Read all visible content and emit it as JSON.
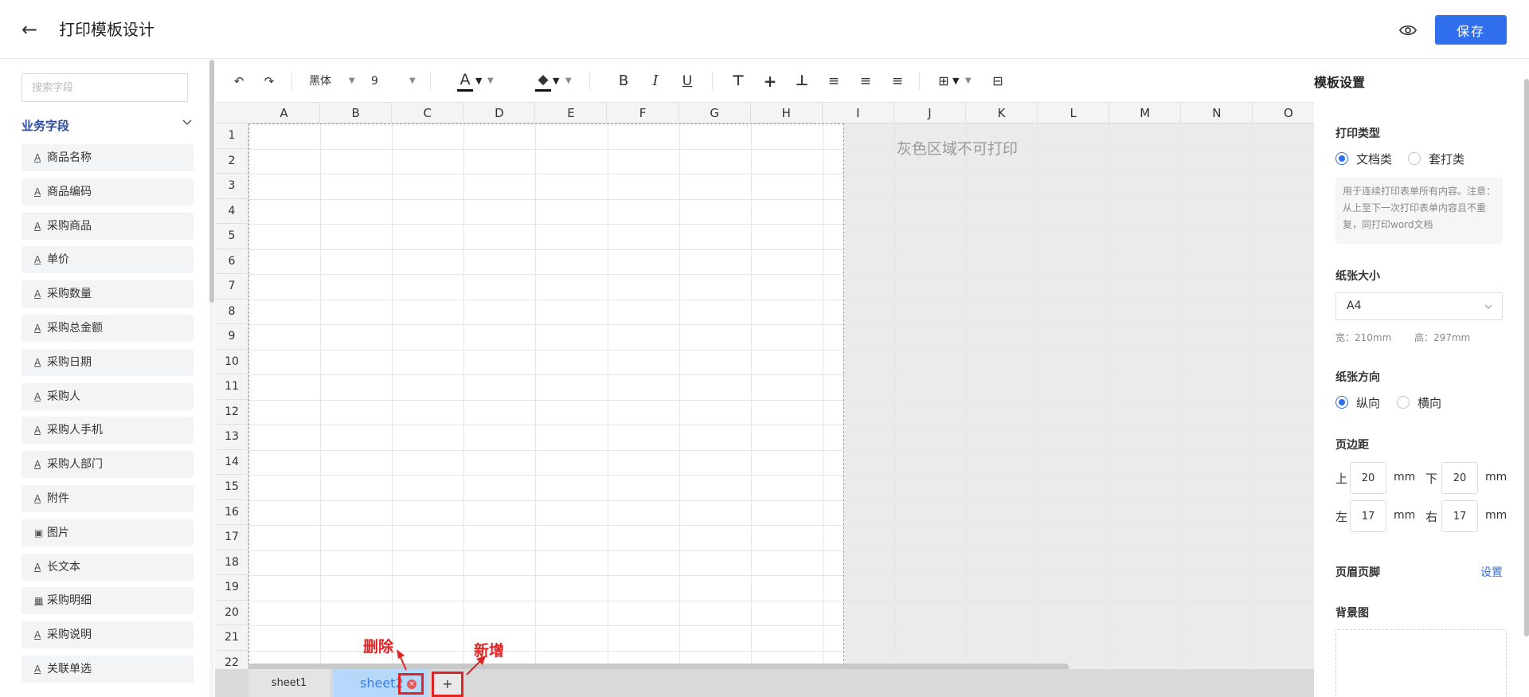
{
  "header": {
    "back_icon": "arrow-left-icon",
    "title": "打印模板设计",
    "preview_icon": "eye-icon",
    "save_label": "保存",
    "accent_color": "#2f6fed"
  },
  "left_panel": {
    "search_placeholder": "搜索字段",
    "section_title": "业务字段",
    "fields": [
      {
        "icon": "A",
        "label": "商品名称"
      },
      {
        "icon": "A",
        "label": "商品编码"
      },
      {
        "icon": "A",
        "label": "采购商品"
      },
      {
        "icon": "A",
        "label": "单价"
      },
      {
        "icon": "A",
        "label": "采购数量"
      },
      {
        "icon": "A",
        "label": "采购总金额"
      },
      {
        "icon": "A",
        "label": "采购日期"
      },
      {
        "icon": "A",
        "label": "采购人"
      },
      {
        "icon": "A",
        "label": "采购人手机"
      },
      {
        "icon": "A",
        "label": "采购人部门"
      },
      {
        "icon": "A",
        "label": "附件"
      },
      {
        "icon": "▣",
        "label": "图片"
      },
      {
        "icon": "A",
        "label": "长文本"
      },
      {
        "icon": "▦",
        "label": "采购明细"
      },
      {
        "icon": "A",
        "label": "采购说明"
      },
      {
        "icon": "A",
        "label": "关联单选"
      }
    ]
  },
  "toolbar": {
    "font_family": "黑体",
    "font_size": "9",
    "text_color_glyph": "A",
    "bold_glyph": "B",
    "italic_glyph": "I",
    "underline_glyph": "U"
  },
  "grid": {
    "columns": [
      "A",
      "B",
      "C",
      "D",
      "E",
      "F",
      "G",
      "H",
      "I",
      "J",
      "K",
      "L",
      "M",
      "N",
      "O"
    ],
    "rows": [
      "1",
      "2",
      "3",
      "4",
      "5",
      "6",
      "7",
      "8",
      "9",
      "10",
      "11",
      "12",
      "13",
      "14",
      "15",
      "16",
      "17",
      "18",
      "19",
      "20",
      "21",
      "22"
    ],
    "gray_note": "灰色区域不可打印"
  },
  "sheets": {
    "tabs": [
      "sheet1",
      "sheet2"
    ],
    "active": "sheet2",
    "add_label": "+",
    "delete_annotation": "删除",
    "add_annotation": "新增"
  },
  "right_panel": {
    "title": "模板设置",
    "print_type_label": "打印类型",
    "print_type_options": [
      "文档类",
      "套打类"
    ],
    "print_type_selected": "文档类",
    "print_type_desc": "用于连续打印表单所有内容。注意：从上至下一次打印表单内容且不重复，同打印word文档",
    "paper_size_label": "纸张大小",
    "paper_size_value": "A4",
    "paper_width": "宽：210mm",
    "paper_height": "高：297mm",
    "orientation_label": "纸张方向",
    "orientation_options": [
      "纵向",
      "横向"
    ],
    "orientation_selected": "纵向",
    "margin_label": "页边距",
    "margins": {
      "top_label": "上",
      "top": "20",
      "bottom_label": "下",
      "bottom": "20",
      "left_label": "左",
      "left": "17",
      "right_label": "右",
      "right": "17",
      "unit": "mm"
    },
    "header_footer_label": "页眉页脚",
    "header_footer_link": "设置",
    "background_label": "背景图"
  }
}
